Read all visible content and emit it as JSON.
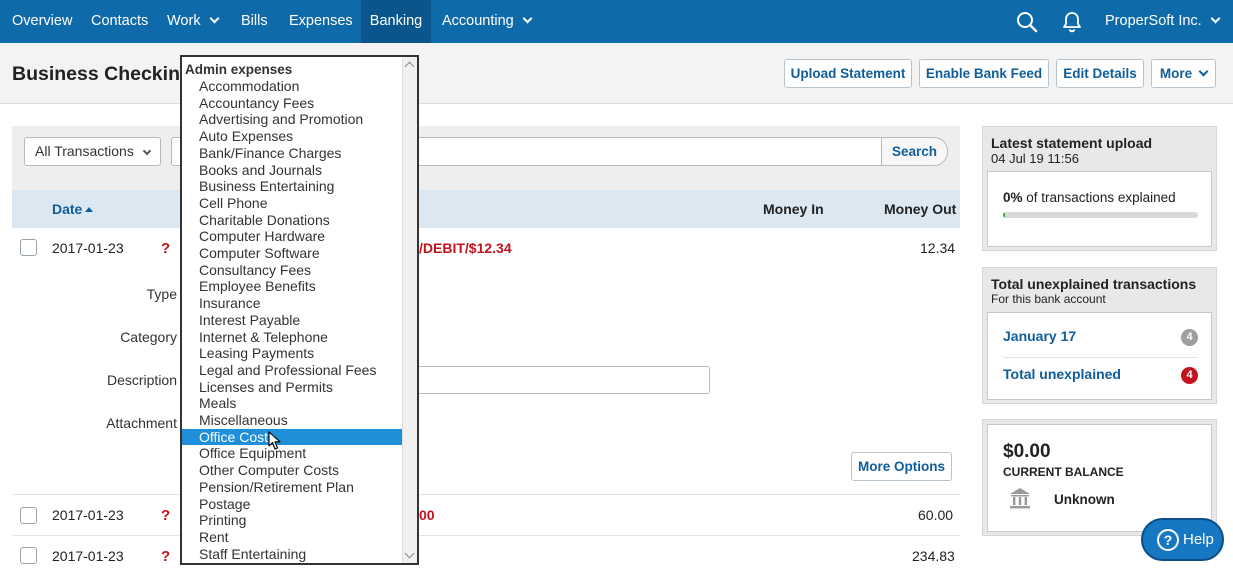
{
  "nav": {
    "items": [
      {
        "label": "Overview"
      },
      {
        "label": "Contacts"
      },
      {
        "label": "Work"
      },
      {
        "label": "Bills"
      },
      {
        "label": "Expenses"
      },
      {
        "label": "Banking"
      },
      {
        "label": "Accounting"
      }
    ],
    "active": "Banking",
    "company": "ProperSoft Inc."
  },
  "header": {
    "title": "Business Checking",
    "buttons": {
      "upload": "Upload Statement",
      "bank_feed": "Enable Bank Feed",
      "edit": "Edit Details",
      "more": "More"
    }
  },
  "filters": {
    "transactions_select": "All Transactions",
    "search_label": "Search"
  },
  "table": {
    "columns": {
      "date": "Date",
      "money_in": "Money In",
      "money_out": "Money Out"
    },
    "rows": [
      {
        "date": "2017-01-23",
        "desc_fragment": "/DEBIT/$12.34",
        "money_out": "12.34"
      },
      {
        "date": "2017-01-23",
        "desc_fragment": "00",
        "money_out": "60.00"
      },
      {
        "date": "2017-01-23",
        "desc_fragment": "",
        "money_out": "234.83"
      }
    ],
    "status_icon": "?"
  },
  "explain_form": {
    "type_label": "Type",
    "category_label": "Category",
    "description_label": "Description",
    "attachment_label": "Attachment",
    "more_options": "More Options"
  },
  "dropdown": {
    "group": "Admin expenses",
    "items": [
      "Accommodation",
      "Accountancy Fees",
      "Advertising and Promotion",
      "Auto Expenses",
      "Bank/Finance Charges",
      "Books and Journals",
      "Business Entertaining",
      "Cell Phone",
      "Charitable Donations",
      "Computer Hardware",
      "Computer Software",
      "Consultancy Fees",
      "Employee Benefits",
      "Insurance",
      "Interest Payable",
      "Internet & Telephone",
      "Leasing Payments",
      "Legal and Professional Fees",
      "Licenses and Permits",
      "Meals",
      "Miscellaneous",
      "Office Costs",
      "Office Equipment",
      "Other Computer Costs",
      "Pension/Retirement Plan",
      "Postage",
      "Printing",
      "Rent",
      "Staff Entertaining"
    ],
    "highlighted": "Office Costs"
  },
  "statement_card": {
    "title": "Latest statement upload",
    "datetime": "04 Jul 19 11:56",
    "percent": "0%",
    "explained_text": "of transactions explained",
    "progress_fraction": 0.01
  },
  "unexplained_card": {
    "title": "Total unexplained transactions",
    "subtitle": "For this bank account",
    "month_label": "January 17",
    "month_count": "4",
    "total_label": "Total unexplained",
    "total_count": "4"
  },
  "balance_card": {
    "amount": "$0.00",
    "label": "CURRENT BALANCE",
    "bank": "Unknown"
  },
  "help": {
    "label": "Help"
  },
  "colors": {
    "nav_bg": "#0f6aa9",
    "accent": "#0f5e9b",
    "alert": "#c3121e",
    "highlight": "#1e8fd8"
  }
}
